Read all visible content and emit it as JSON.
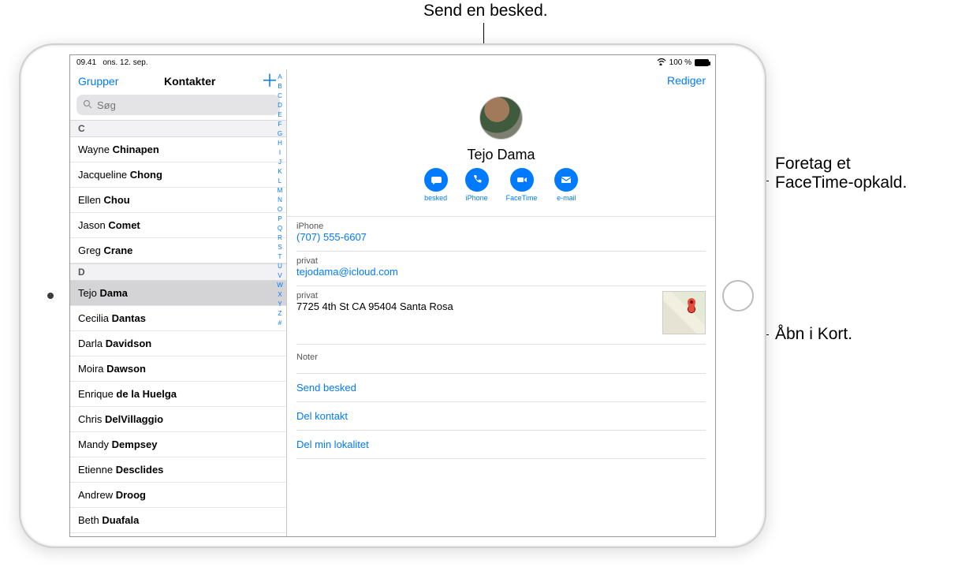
{
  "annotations": {
    "top": "Send en besked.",
    "facetime": "Foretag et\nFaceTime-opkald.",
    "maps": "Åbn i Kort."
  },
  "status": {
    "time": "09.41",
    "date": "ons. 12. sep.",
    "battery_pct": "100 %"
  },
  "sidebar": {
    "groups_label": "Grupper",
    "title": "Kontakter",
    "search_placeholder": "Søg",
    "sections": [
      {
        "letter": "C",
        "items": [
          {
            "first": "Wayne",
            "last": "Chinapen"
          },
          {
            "first": "Jacqueline",
            "last": "Chong"
          },
          {
            "first": "Ellen",
            "last": "Chou"
          },
          {
            "first": "Jason",
            "last": "Comet"
          },
          {
            "first": "Greg",
            "last": "Crane"
          }
        ]
      },
      {
        "letter": "D",
        "items": [
          {
            "first": "Tejo",
            "last": "Dama",
            "selected": true
          },
          {
            "first": "Cecilia",
            "last": "Dantas"
          },
          {
            "first": "Darla",
            "last": "Davidson"
          },
          {
            "first": "Moira",
            "last": "Dawson"
          },
          {
            "first": "Enrique",
            "last": "de la Huelga"
          },
          {
            "first": "Chris",
            "last": "DelVillaggio"
          },
          {
            "first": "Mandy",
            "last": "Dempsey"
          },
          {
            "first": "Etienne",
            "last": "Desclides"
          },
          {
            "first": "Andrew",
            "last": "Droog"
          },
          {
            "first": "Beth",
            "last": "Duafala"
          }
        ]
      }
    ],
    "index_letters": [
      "A",
      "B",
      "C",
      "D",
      "E",
      "F",
      "G",
      "H",
      "I",
      "J",
      "K",
      "L",
      "M",
      "N",
      "O",
      "P",
      "Q",
      "R",
      "S",
      "T",
      "U",
      "V",
      "W",
      "X",
      "Y",
      "Z",
      "#"
    ]
  },
  "detail": {
    "edit_label": "Rediger",
    "name": "Tejo Dama",
    "actions": {
      "message": "besked",
      "phone": "iPhone",
      "facetime": "FaceTime",
      "email": "e-mail"
    },
    "phone": {
      "label": "iPhone",
      "value": "(707) 555-6607"
    },
    "email": {
      "label": "privat",
      "value": "tejodama@icloud.com"
    },
    "address": {
      "label": "privat",
      "value": "7725 4th St CA 95404 Santa Rosa"
    },
    "notes_label": "Noter",
    "row_actions": {
      "send_message": "Send besked",
      "share_contact": "Del kontakt",
      "share_location": "Del min lokalitet"
    }
  }
}
